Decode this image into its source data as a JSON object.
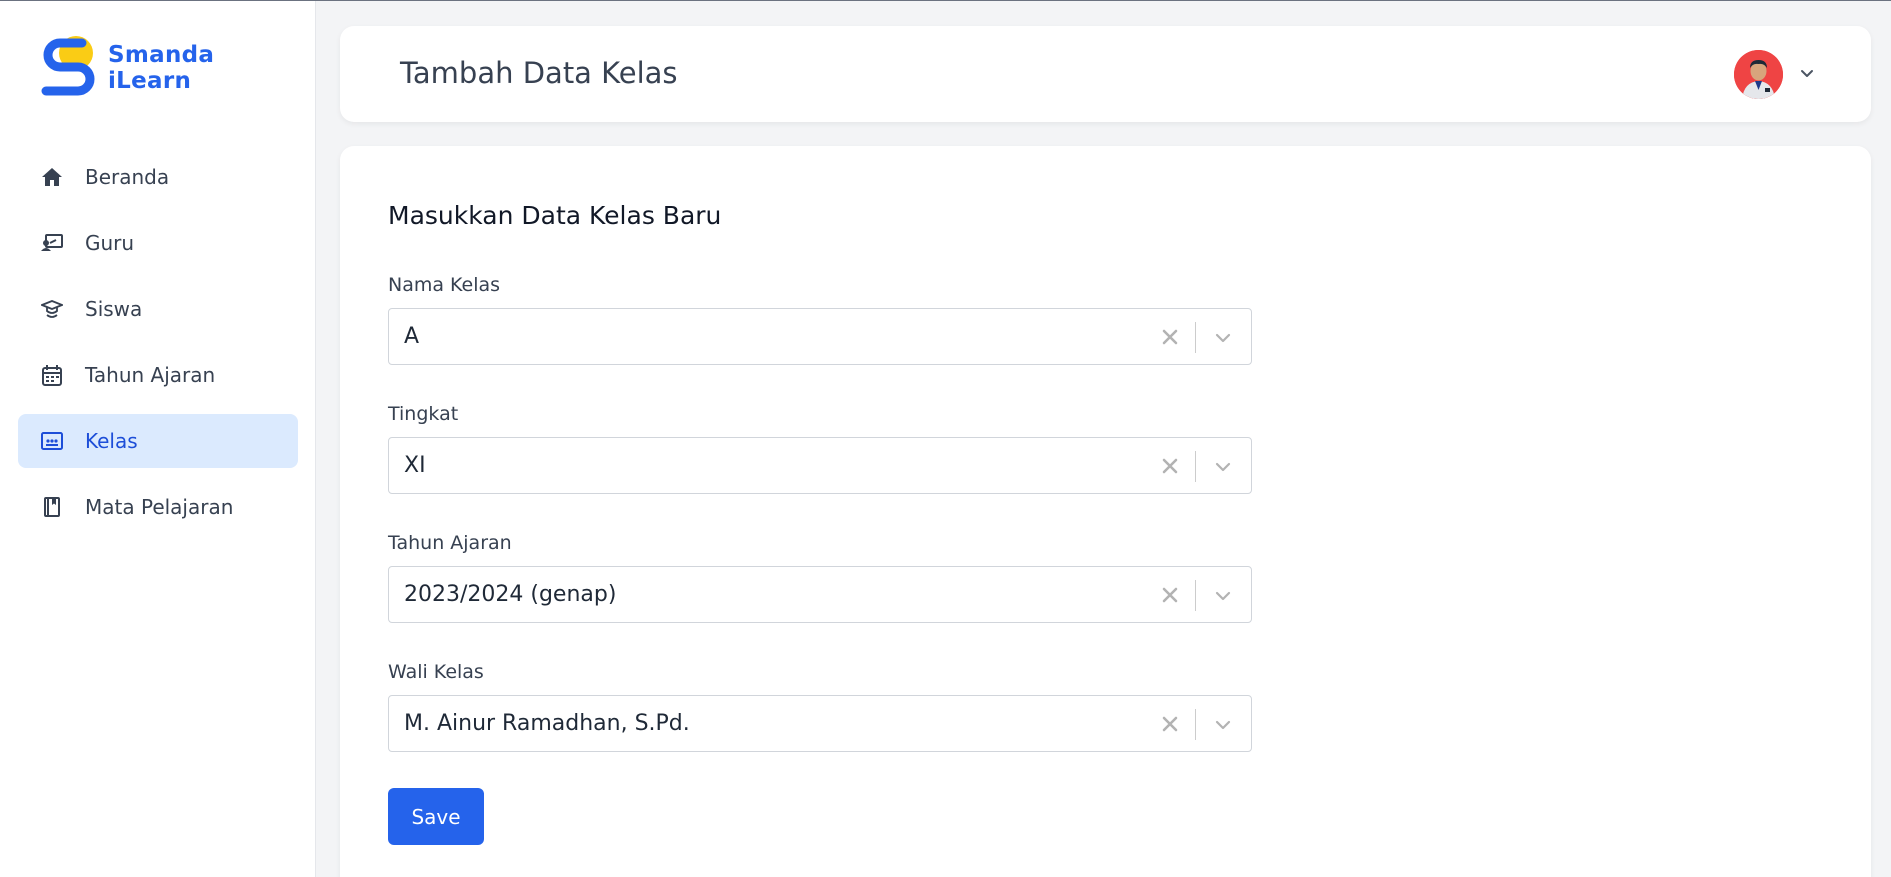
{
  "app": {
    "logo_line1": "Smanda",
    "logo_line2": "iLearn"
  },
  "sidebar": {
    "items": [
      {
        "label": "Beranda",
        "icon": "home-icon",
        "active": false
      },
      {
        "label": "Guru",
        "icon": "teacher-icon",
        "active": false
      },
      {
        "label": "Siswa",
        "icon": "student-icon",
        "active": false
      },
      {
        "label": "Tahun Ajaran",
        "icon": "calendar-icon",
        "active": false
      },
      {
        "label": "Kelas",
        "icon": "classroom-icon",
        "active": true
      },
      {
        "label": "Mata Pelajaran",
        "icon": "book-icon",
        "active": false
      }
    ]
  },
  "header": {
    "title": "Tambah Data Kelas"
  },
  "form": {
    "title": "Masukkan Data Kelas Baru",
    "fields": [
      {
        "label": "Nama Kelas",
        "value": "A"
      },
      {
        "label": "Tingkat",
        "value": "XI"
      },
      {
        "label": "Tahun Ajaran",
        "value": "2023/2024 (genap)"
      },
      {
        "label": "Wali Kelas",
        "value": "M. Ainur Ramadhan, S.Pd."
      }
    ],
    "save_label": "Save"
  },
  "colors": {
    "accent": "#2563eb",
    "active_bg": "#dbeafe",
    "logo_yellow": "#facc15"
  }
}
